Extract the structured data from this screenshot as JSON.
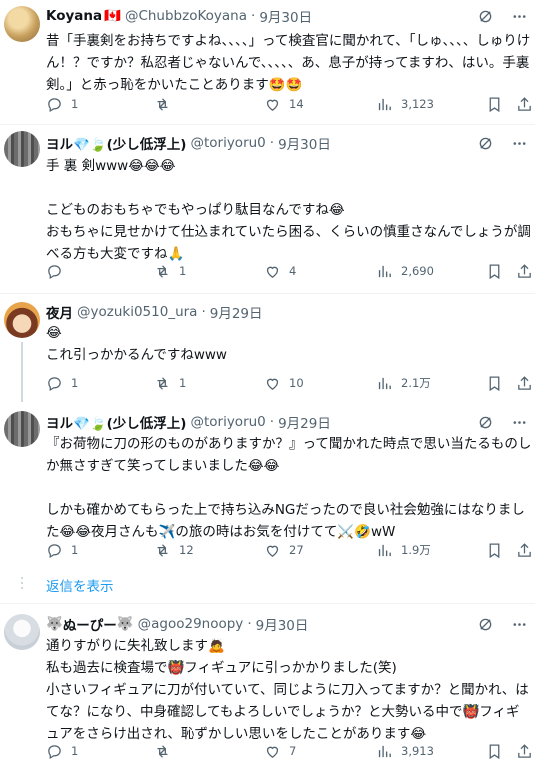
{
  "tweets": [
    {
      "display_name": "Koyana",
      "flag": "🇨🇦",
      "handle": "@ChubbzoKoyana",
      "date": "9月30日",
      "text": "昔「手裏剣をお持ちですよね、、、、」って検査官に聞かれて、「しゅ、、、、しゅりけん！？ですか？私忍者じゃないんで、、、、、あ、息子が持ってますわ、はい。手裏剣。」と赤っ恥をかいたことあります🤩🤩",
      "replies": "1",
      "retweets": "",
      "likes": "14",
      "views": "3,123"
    },
    {
      "display_name": "ヨル",
      "name_emoji": "💎🍃(少し低浮上)",
      "handle": "@toriyoru0",
      "date": "9月30日",
      "text": "手 裏 剣www😂😂😂\n\nこどものおもちゃでもやっぱり駄目なんですね😂\nおもちゃに見せかけて仕込まれていたら困る、くらいの慎重さなんでしょうが調べる方も大変ですね🙏",
      "replies": "",
      "retweets": "1",
      "likes": "4",
      "views": "2,690"
    },
    {
      "display_name": "夜月",
      "handle": "@yozuki0510_ura",
      "date": "9月29日",
      "text": "😂\nこれ引っかかるんですねwww",
      "replies": "1",
      "retweets": "1",
      "likes": "10",
      "views": "2.1万"
    },
    {
      "display_name": "ヨル",
      "name_emoji": "💎🍃(少し低浮上)",
      "handle": "@toriyoru0",
      "date": "9月29日",
      "text": "『お荷物に刀の形のものがありますか？』って聞かれた時点で思い当たるものしか無さすぎて笑ってしまいました😂😂\n\nしかも確かめてもらった上で持ち込みNGだったので良い社会勉強にはなりました😂😂夜月さんも✈️の旅の時はお気を付けてて⚔️🤣wW",
      "replies": "1",
      "retweets": "12",
      "likes": "27",
      "views": "1.9万"
    },
    {
      "display_name": "ぬーぴー",
      "name_prefix": "🐺",
      "name_suffix": "🐺",
      "handle": "@agoo29noopy",
      "date": "9月30日",
      "text": "通りすがりに失礼致します🙇\n私も過去に検査場で👹フィギュアに引っかかりました(笑)\n小さいフィギュアに刀が付いていて、同じように刀入ってますか？と聞かれ、はてな？になり、中身確認してもよろしいでしょうか？と大勢いる中で👹フィギュアをさらけ出され、恥ずかしい思いをしたことがあります😂",
      "replies": "1",
      "retweets": "",
      "likes": "7",
      "views": "3,913"
    }
  ],
  "show_replies_label": "返信を表示",
  "colors": {
    "muted": "#536471",
    "link": "#1d9bf0",
    "divider": "#eff3f4"
  }
}
